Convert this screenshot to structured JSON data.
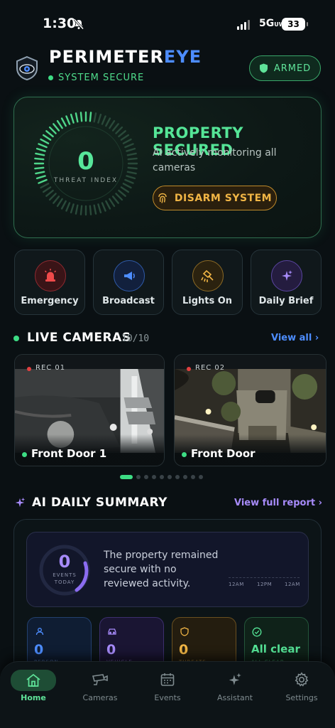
{
  "status_bar": {
    "time": "1:30",
    "network": "5G",
    "network_sup": "UW",
    "battery": "33"
  },
  "header": {
    "brand_primary": "PERIMETER",
    "brand_accent": "EYE",
    "status": "SYSTEM SECURE",
    "armed_label": "ARMED"
  },
  "hero": {
    "threat_value": "0",
    "threat_label": "THREAT INDEX",
    "title": "PROPERTY SECURED",
    "description": "AI actively monitoring all cameras",
    "disarm_label": "DISARM SYSTEM"
  },
  "quick_actions": [
    {
      "label": "Emergency",
      "icon": "siren-icon"
    },
    {
      "label": "Broadcast",
      "icon": "megaphone-icon"
    },
    {
      "label": "Lights On",
      "icon": "floodlight-icon"
    },
    {
      "label": "Daily Brief",
      "icon": "sparkles-icon"
    }
  ],
  "live_cameras": {
    "title": "LIVE CAMERAS",
    "count": "10/10",
    "view_all": "View all",
    "cameras": [
      {
        "rec": "REC 01",
        "name": "Front Door 1"
      },
      {
        "rec": "REC 02",
        "name": "Front Door"
      }
    ],
    "page_count": 10,
    "active_page": 0
  },
  "ai_summary": {
    "title": "AI DAILY SUMMARY",
    "view_report": "View full report",
    "events_value": "0",
    "events_label_1": "EVENTS",
    "events_label_2": "TODAY",
    "text": "The property remained secure with no reviewed activity.",
    "timeline_labels": [
      "12AM",
      "12PM",
      "12AM"
    ],
    "stats": [
      {
        "value": "0",
        "sub": "PERSON",
        "color": "#4d8dff"
      },
      {
        "value": "0",
        "sub": "VEHICLE",
        "color": "#a78bfa"
      },
      {
        "value": "0",
        "sub": "THREATS",
        "color": "#f0b545"
      },
      {
        "value": "All clear",
        "sub": "ALL CLEAR",
        "color": "#55e597"
      }
    ]
  },
  "tabs": [
    {
      "label": "Home",
      "icon": "home-icon",
      "active": true
    },
    {
      "label": "Cameras",
      "icon": "camera-icon",
      "active": false
    },
    {
      "label": "Events",
      "icon": "calendar-icon",
      "active": false
    },
    {
      "label": "Assistant",
      "icon": "sparkles-icon",
      "active": false
    },
    {
      "label": "Settings",
      "icon": "gear-icon",
      "active": false
    }
  ],
  "colors": {
    "accent_green": "#55e597",
    "accent_blue": "#4d8dff",
    "accent_purple": "#a78bfa",
    "accent_amber": "#f0b545",
    "background": "#0a1013"
  }
}
